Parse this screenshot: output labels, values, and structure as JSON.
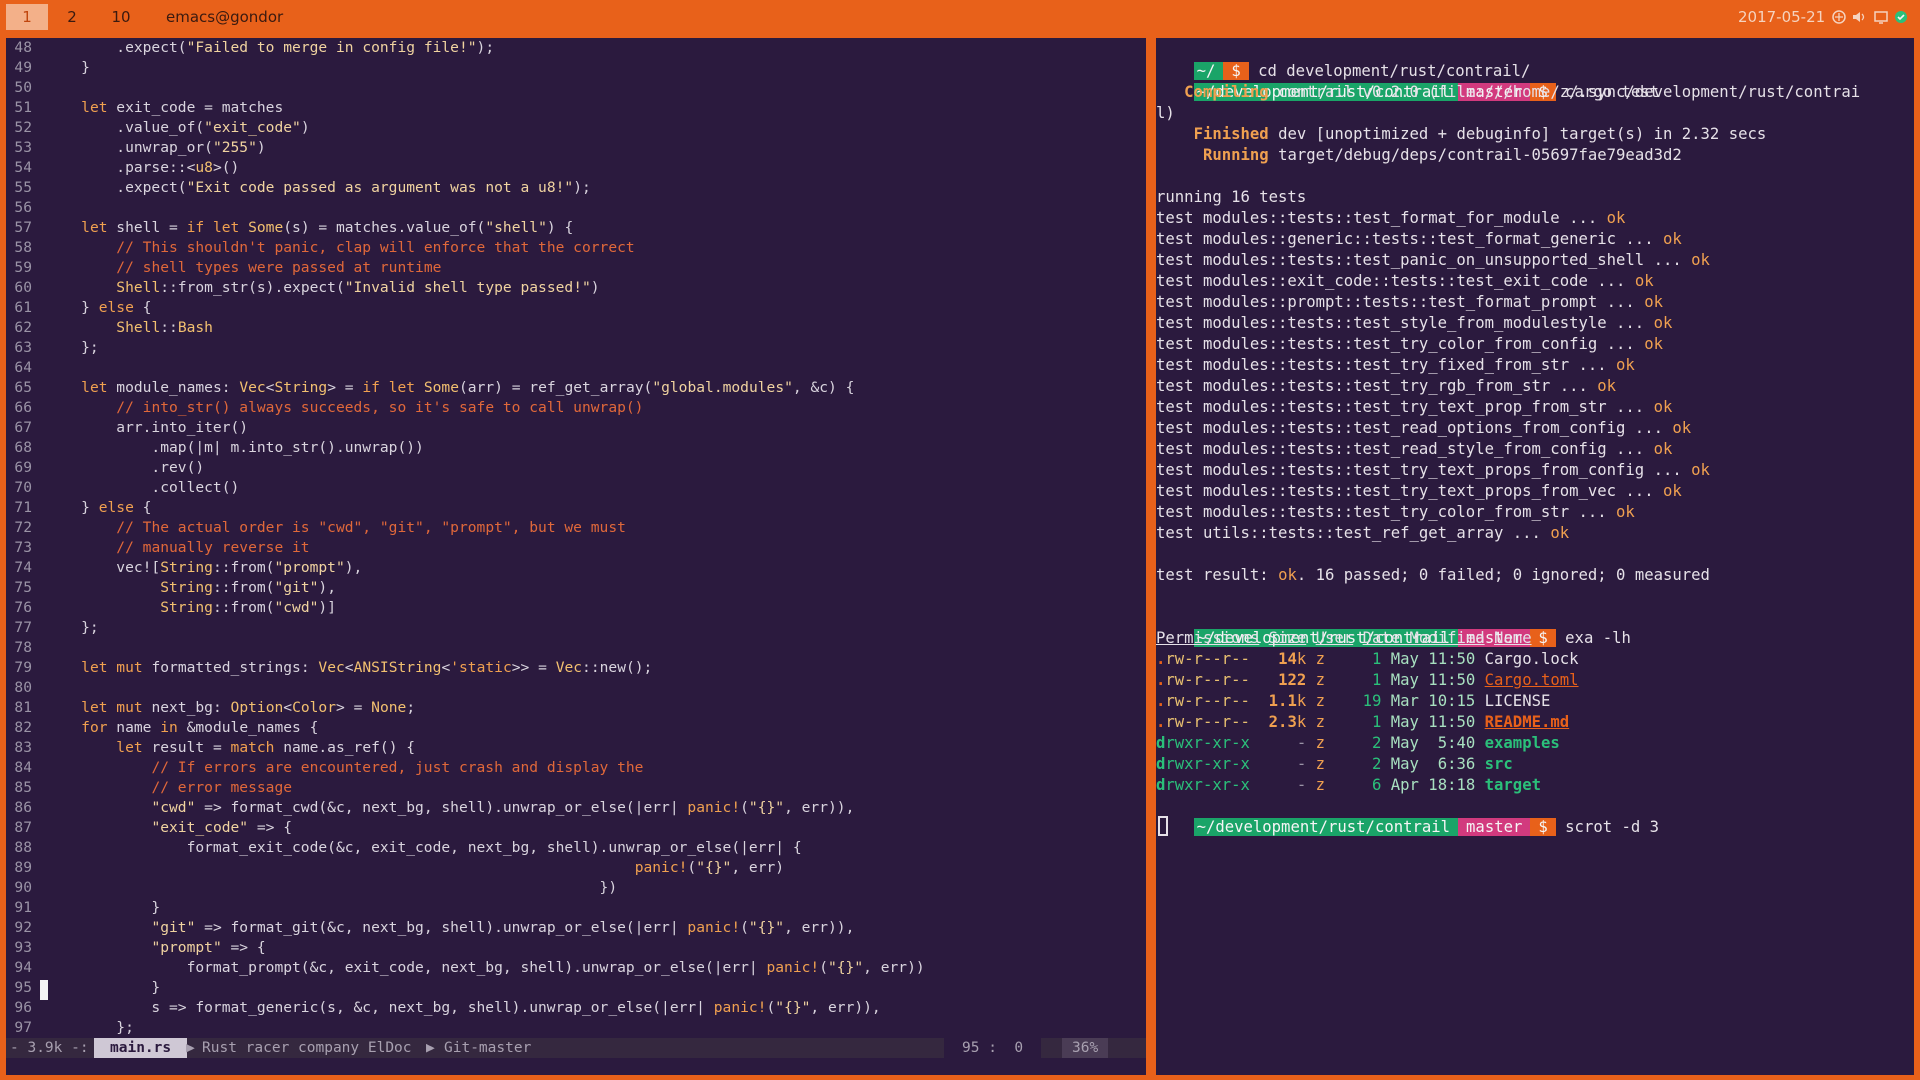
{
  "topbar": {
    "workspaces": [
      "1",
      "2",
      "10"
    ],
    "window_title": "emacs@gondor",
    "date": "2017-05-21",
    "tray_icons": [
      "network-icon",
      "volume-icon",
      "display-icon",
      "status-icon"
    ]
  },
  "editor": {
    "lines": [
      {
        "n": "48",
        "t": [
          [
            "        .expect(",
            ""
          ],
          [
            "\"Failed to merge in config file!\"",
            "str"
          ],
          [
            ");",
            ""
          ]
        ]
      },
      {
        "n": "49",
        "t": [
          [
            "    }",
            ""
          ]
        ]
      },
      {
        "n": "50",
        "t": []
      },
      {
        "n": "51",
        "t": [
          [
            "    ",
            ""
          ],
          [
            "let",
            "kw"
          ],
          [
            " exit_code = matches",
            ""
          ]
        ]
      },
      {
        "n": "52",
        "t": [
          [
            "        .value_of(",
            ""
          ],
          [
            "\"exit_code\"",
            "str"
          ],
          [
            ")",
            ""
          ]
        ]
      },
      {
        "n": "53",
        "t": [
          [
            "        .unwrap_or(",
            ""
          ],
          [
            "\"255\"",
            "str"
          ],
          [
            ")",
            ""
          ]
        ]
      },
      {
        "n": "54",
        "t": [
          [
            "        .parse::<",
            ""
          ],
          [
            "u8",
            "ty"
          ],
          [
            ">()",
            ""
          ]
        ]
      },
      {
        "n": "55",
        "t": [
          [
            "        .expect(",
            ""
          ],
          [
            "\"Exit code passed as argument was not a u8!\"",
            "str"
          ],
          [
            ");",
            ""
          ]
        ]
      },
      {
        "n": "56",
        "t": []
      },
      {
        "n": "57",
        "t": [
          [
            "    ",
            ""
          ],
          [
            "let",
            "kw"
          ],
          [
            " shell = ",
            ""
          ],
          [
            "if let",
            "kw"
          ],
          [
            " ",
            ""
          ],
          [
            "Some",
            "ty"
          ],
          [
            "(s) = matches.value_of(",
            ""
          ],
          [
            "\"shell\"",
            "str"
          ],
          [
            ") {",
            ""
          ]
        ]
      },
      {
        "n": "58",
        "t": [
          [
            "        ",
            ""
          ],
          [
            "// This shouldn't panic, clap will enforce that the correct",
            "cm"
          ]
        ]
      },
      {
        "n": "59",
        "t": [
          [
            "        ",
            ""
          ],
          [
            "// shell types were passed at runtime",
            "cm"
          ]
        ]
      },
      {
        "n": "60",
        "t": [
          [
            "        ",
            ""
          ],
          [
            "Shell",
            "ty"
          ],
          [
            "::from_str(s).expect(",
            ""
          ],
          [
            "\"Invalid shell type passed!\"",
            "str"
          ],
          [
            ")",
            ""
          ]
        ]
      },
      {
        "n": "61",
        "t": [
          [
            "    } ",
            ""
          ],
          [
            "else",
            "kw"
          ],
          [
            " {",
            ""
          ]
        ]
      },
      {
        "n": "62",
        "t": [
          [
            "        ",
            ""
          ],
          [
            "Shell",
            "ty"
          ],
          [
            "::",
            ""
          ],
          [
            "Bash",
            "ty"
          ]
        ]
      },
      {
        "n": "63",
        "t": [
          [
            "    };",
            ""
          ]
        ]
      },
      {
        "n": "64",
        "t": []
      },
      {
        "n": "65",
        "t": [
          [
            "    ",
            ""
          ],
          [
            "let",
            "kw"
          ],
          [
            " module_names: ",
            ""
          ],
          [
            "Vec",
            "ty"
          ],
          [
            "<",
            ""
          ],
          [
            "String",
            "ty"
          ],
          [
            "> = ",
            ""
          ],
          [
            "if let",
            "kw"
          ],
          [
            " ",
            ""
          ],
          [
            "Some",
            "ty"
          ],
          [
            "(arr) = ref_get_array(",
            ""
          ],
          [
            "\"global.modules\"",
            "str"
          ],
          [
            ", &c) {",
            ""
          ]
        ]
      },
      {
        "n": "66",
        "t": [
          [
            "        ",
            ""
          ],
          [
            "// into_str() always succeeds, so it's safe to call unwrap()",
            "cm"
          ]
        ]
      },
      {
        "n": "67",
        "t": [
          [
            "        arr.into_iter()",
            ""
          ]
        ]
      },
      {
        "n": "68",
        "t": [
          [
            "            .map(|m| m.into_str().unwrap())",
            ""
          ]
        ]
      },
      {
        "n": "69",
        "t": [
          [
            "            .rev()",
            ""
          ]
        ]
      },
      {
        "n": "70",
        "t": [
          [
            "            .collect()",
            ""
          ]
        ]
      },
      {
        "n": "71",
        "t": [
          [
            "    } ",
            ""
          ],
          [
            "else",
            "kw"
          ],
          [
            " {",
            ""
          ]
        ]
      },
      {
        "n": "72",
        "t": [
          [
            "        ",
            ""
          ],
          [
            "// The actual order is \"cwd\", \"git\", \"prompt\", but we must",
            "cm"
          ]
        ]
      },
      {
        "n": "73",
        "t": [
          [
            "        ",
            ""
          ],
          [
            "// manually reverse it",
            "cm"
          ]
        ]
      },
      {
        "n": "74",
        "t": [
          [
            "        vec![",
            ""
          ],
          [
            "String",
            "ty"
          ],
          [
            "::from(",
            ""
          ],
          [
            "\"prompt\"",
            "str"
          ],
          [
            "),",
            ""
          ]
        ]
      },
      {
        "n": "75",
        "t": [
          [
            "             ",
            ""
          ],
          [
            "String",
            "ty"
          ],
          [
            "::from(",
            ""
          ],
          [
            "\"git\"",
            "str"
          ],
          [
            "),",
            ""
          ]
        ]
      },
      {
        "n": "76",
        "t": [
          [
            "             ",
            ""
          ],
          [
            "String",
            "ty"
          ],
          [
            "::from(",
            ""
          ],
          [
            "\"cwd\"",
            "str"
          ],
          [
            ")]",
            ""
          ]
        ]
      },
      {
        "n": "77",
        "t": [
          [
            "    };",
            ""
          ]
        ]
      },
      {
        "n": "78",
        "t": []
      },
      {
        "n": "79",
        "t": [
          [
            "    ",
            ""
          ],
          [
            "let mut",
            "kw"
          ],
          [
            " formatted_strings: ",
            ""
          ],
          [
            "Vec",
            "ty"
          ],
          [
            "<",
            ""
          ],
          [
            "ANSIString",
            "ty"
          ],
          [
            "<",
            ""
          ],
          [
            "'static",
            "kw"
          ],
          [
            ">> = ",
            ""
          ],
          [
            "Vec",
            "ty"
          ],
          [
            "::new();",
            ""
          ]
        ]
      },
      {
        "n": "80",
        "t": []
      },
      {
        "n": "81",
        "t": [
          [
            "    ",
            ""
          ],
          [
            "let mut",
            "kw"
          ],
          [
            " next_bg: ",
            ""
          ],
          [
            "Option",
            "ty"
          ],
          [
            "<",
            ""
          ],
          [
            "Color",
            "ty"
          ],
          [
            "> = ",
            ""
          ],
          [
            "None",
            "ty"
          ],
          [
            ";",
            ""
          ]
        ]
      },
      {
        "n": "82",
        "t": [
          [
            "    ",
            ""
          ],
          [
            "for",
            "kw"
          ],
          [
            " name ",
            ""
          ],
          [
            "in",
            "kw"
          ],
          [
            " &module_names {",
            ""
          ]
        ]
      },
      {
        "n": "83",
        "t": [
          [
            "        ",
            ""
          ],
          [
            "let",
            "kw"
          ],
          [
            " result = ",
            ""
          ],
          [
            "match",
            "kw"
          ],
          [
            " name.as_ref() {",
            ""
          ]
        ]
      },
      {
        "n": "84",
        "t": [
          [
            "            ",
            ""
          ],
          [
            "// If errors are encountered, just crash and display the",
            "cm"
          ]
        ]
      },
      {
        "n": "85",
        "t": [
          [
            "            ",
            ""
          ],
          [
            "// error message",
            "cm"
          ]
        ]
      },
      {
        "n": "86",
        "t": [
          [
            "            ",
            ""
          ],
          [
            "\"cwd\"",
            "str"
          ],
          [
            " => format_cwd(&c, next_bg, shell).unwrap_or_else(|err| ",
            ""
          ],
          [
            "panic!",
            "kw"
          ],
          [
            "(",
            ""
          ],
          [
            "\"{}\"",
            "str"
          ],
          [
            ", err)),",
            ""
          ]
        ]
      },
      {
        "n": "87",
        "t": [
          [
            "            ",
            ""
          ],
          [
            "\"exit_code\"",
            "str"
          ],
          [
            " => {",
            ""
          ]
        ]
      },
      {
        "n": "88",
        "t": [
          [
            "                format_exit_code(&c, exit_code, next_bg, shell).unwrap_or_else(|err| {",
            ""
          ]
        ]
      },
      {
        "n": "89",
        "t": [
          [
            "                                                                   ",
            ""
          ],
          [
            "panic!",
            "kw"
          ],
          [
            "(",
            ""
          ],
          [
            "\"{}\"",
            "str"
          ],
          [
            ", err)",
            ""
          ]
        ]
      },
      {
        "n": "90",
        "t": [
          [
            "                                                               })",
            ""
          ]
        ]
      },
      {
        "n": "91",
        "t": [
          [
            "            }",
            ""
          ]
        ]
      },
      {
        "n": "92",
        "t": [
          [
            "            ",
            ""
          ],
          [
            "\"git\"",
            "str"
          ],
          [
            " => format_git(&c, next_bg, shell).unwrap_or_else(|err| ",
            ""
          ],
          [
            "panic!",
            "kw"
          ],
          [
            "(",
            ""
          ],
          [
            "\"{}\"",
            "str"
          ],
          [
            ", err)),",
            ""
          ]
        ]
      },
      {
        "n": "93",
        "t": [
          [
            "            ",
            ""
          ],
          [
            "\"prompt\"",
            "str"
          ],
          [
            " => {",
            ""
          ]
        ]
      },
      {
        "n": "94",
        "t": [
          [
            "                format_prompt(&c, exit_code, next_bg, shell).unwrap_or_else(|err| ",
            ""
          ],
          [
            "panic!",
            "kw"
          ],
          [
            "(",
            ""
          ],
          [
            "\"{}\"",
            "str"
          ],
          [
            ", err))",
            ""
          ]
        ]
      },
      {
        "n": "95",
        "t": [
          [
            "            }",
            ""
          ]
        ]
      },
      {
        "n": "96",
        "t": [
          [
            "            s => format_generic(s, &c, next_bg, shell).unwrap_or_else(|err| ",
            ""
          ],
          [
            "panic!",
            "kw"
          ],
          [
            "(",
            ""
          ],
          [
            "\"{}\"",
            "str"
          ],
          [
            ", err)),",
            ""
          ]
        ]
      },
      {
        "n": "97",
        "t": [
          [
            "        };",
            ""
          ]
        ]
      }
    ],
    "modeline": {
      "size": "- 3.9k -:",
      "filename": "main.rs",
      "modes": "Rust racer company ElDoc",
      "vcs": "Git-master",
      "position": "95 :  0",
      "percent": "36%"
    }
  },
  "terminal": {
    "prompt_home": "~/",
    "dollar": "$",
    "cmd_cd": "cd development/rust/contrail/",
    "prompt_dir": "~/development/rust/contrail",
    "branch": "master",
    "cmd_test": "cargo test",
    "compiling_label": "Compiling",
    "compiling_rest": "contrail v0.2.0 (file:///home/z/.sync/development/rust/contrai",
    "compiling_wrap": "l)",
    "finished_label": "Finished",
    "finished_rest": "dev [unoptimized + debuginfo] target(s) in 2.32 secs",
    "running_label": "Running",
    "running_rest": "target/debug/deps/contrail-05697fae79ead3d2",
    "running_tests": "running 16 tests",
    "ok": "ok",
    "tests": [
      "test modules::tests::test_format_for_module ... ",
      "test modules::generic::tests::test_format_generic ... ",
      "test modules::tests::test_panic_on_unsupported_shell ... ",
      "test modules::exit_code::tests::test_exit_code ... ",
      "test modules::prompt::tests::test_format_prompt ... ",
      "test modules::tests::test_style_from_modulestyle ... ",
      "test modules::tests::test_try_color_from_config ... ",
      "test modules::tests::test_try_fixed_from_str ... ",
      "test modules::tests::test_try_rgb_from_str ... ",
      "test modules::tests::test_try_text_prop_from_str ... ",
      "test modules::tests::test_read_options_from_config ... ",
      "test modules::tests::test_read_style_from_config ... ",
      "test modules::tests::test_try_text_props_from_config ... ",
      "test modules::tests::test_try_text_props_from_vec ... ",
      "test modules::tests::test_try_color_from_str ... ",
      "test utils::tests::test_ref_get_array ... "
    ],
    "result_prefix": "test result: ",
    "result_rest": ". 16 passed; 0 failed; 0 ignored; 0 measured",
    "cmd_exa": "exa -lh",
    "exa_headers": [
      "Permissions",
      "Size",
      "User",
      "Date Modified",
      "Name"
    ],
    "files": [
      {
        "type": ".",
        "perm": "rw-r--r--",
        "size": "14",
        "unit": "k",
        "user": "z",
        "day": "1",
        "rest": "May 11:50",
        "name": "Cargo.lock",
        "kind": "plain"
      },
      {
        "type": ".",
        "perm": "rw-r--r--",
        "size": "122",
        "unit": "",
        "user": "z",
        "day": "1",
        "rest": "May 11:50",
        "name": "Cargo.toml",
        "kind": "toml"
      },
      {
        "type": ".",
        "perm": "rw-r--r--",
        "size": "1.1",
        "unit": "k",
        "user": "z",
        "day": "19",
        "rest": "Mar 10:15",
        "name": "LICENSE",
        "kind": "plain"
      },
      {
        "type": ".",
        "perm": "rw-r--r--",
        "size": "2.3",
        "unit": "k",
        "user": "z",
        "day": "1",
        "rest": "May 11:50",
        "name": "README.md",
        "kind": "md"
      },
      {
        "type": "d",
        "perm": "rwxr-xr-x",
        "size": "-",
        "unit": "",
        "user": "z",
        "day": "2",
        "rest": "May  5:40",
        "name": "examples",
        "kind": "dir"
      },
      {
        "type": "d",
        "perm": "rwxr-xr-x",
        "size": "-",
        "unit": "",
        "user": "z",
        "day": "2",
        "rest": "May  6:36",
        "name": "src",
        "kind": "dir"
      },
      {
        "type": "d",
        "perm": "rwxr-xr-x",
        "size": "-",
        "unit": "",
        "user": "z",
        "day": "6",
        "rest": "Apr 18:18",
        "name": "target",
        "kind": "dir"
      }
    ],
    "cmd_scrot": "scrot -d 3"
  }
}
